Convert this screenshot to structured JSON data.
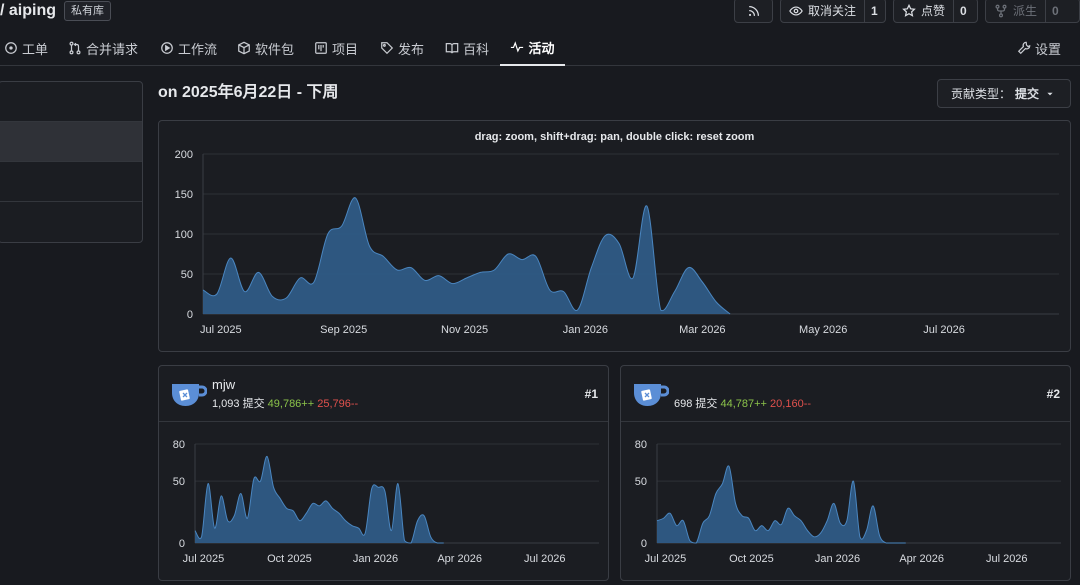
{
  "header": {
    "repo_title": "/ aiping",
    "private_badge": "私有库",
    "rss_icon": "rss-icon",
    "watch": {
      "label": "取消关注",
      "count": "1"
    },
    "star": {
      "label": "点赞",
      "count": "0"
    },
    "fork": {
      "label": "派生",
      "count": "0"
    }
  },
  "tabs": [
    {
      "label": "工单",
      "icon": "issue-icon"
    },
    {
      "label": "合并请求",
      "icon": "pull-request-icon"
    },
    {
      "label": "工作流",
      "icon": "actions-icon"
    },
    {
      "label": "软件包",
      "icon": "package-icon"
    },
    {
      "label": "项目",
      "icon": "project-icon"
    },
    {
      "label": "发布",
      "icon": "tag-icon"
    },
    {
      "label": "百科",
      "icon": "book-icon"
    },
    {
      "label": "活动",
      "icon": "pulse-icon",
      "active": true
    },
    {
      "label": "设置",
      "icon": "tools-icon"
    }
  ],
  "period_title": "on 2025年6月22日 - 下周",
  "contribution_type": {
    "label": "贡献类型：",
    "value": "提交"
  },
  "main_chart": {
    "hint": "drag: zoom, shift+drag: pan, double click: reset zoom"
  },
  "contributors": [
    {
      "name": "mjw",
      "commits": "1,093 提交",
      "additions": "49,786++",
      "deletions": "25,796--",
      "rank": "#1"
    },
    {
      "name": "",
      "commits": "698 提交",
      "additions": "44,787++",
      "deletions": "20,160--",
      "rank": "#2"
    }
  ],
  "colors": {
    "area_fill": "#2f5b86",
    "area_stroke": "#4a86c0",
    "additions": "#8bc34a",
    "deletions": "#e0514d"
  },
  "chart_data": [
    {
      "type": "area",
      "title": "",
      "x_ticks": [
        "Jul 2025",
        "Sep 2025",
        "Nov 2025",
        "Jan 2026",
        "Mar 2026",
        "May 2026",
        "Jul 2026"
      ],
      "x_range": [
        "2025-06-22",
        "2026-08-28"
      ],
      "ylim": [
        0,
        200
      ],
      "y_ticks": [
        0,
        50,
        100,
        150,
        200
      ],
      "grid": true,
      "series": [
        {
          "x": [
            "2025-06-22",
            "2025-06-29",
            "2025-07-06",
            "2025-07-13",
            "2025-07-20",
            "2025-07-27",
            "2025-08-03",
            "2025-08-10",
            "2025-08-17",
            "2025-08-24",
            "2025-08-31",
            "2025-09-07",
            "2025-09-14",
            "2025-09-21",
            "2025-09-28",
            "2025-10-05",
            "2025-10-12",
            "2025-10-19",
            "2025-10-26",
            "2025-11-02",
            "2025-11-09",
            "2025-11-16",
            "2025-11-23",
            "2025-11-30",
            "2025-12-07",
            "2025-12-14",
            "2025-12-21",
            "2025-12-28",
            "2026-01-04",
            "2026-01-11",
            "2026-01-18",
            "2026-01-25",
            "2026-02-01",
            "2026-02-08",
            "2026-02-15",
            "2026-02-22",
            "2026-03-01",
            "2026-03-08",
            "2026-03-15"
          ],
          "values": [
            30,
            25,
            70,
            28,
            52,
            22,
            20,
            45,
            40,
            100,
            110,
            145,
            85,
            72,
            55,
            58,
            42,
            48,
            38,
            45,
            52,
            55,
            75,
            68,
            72,
            30,
            28,
            5,
            58,
            98,
            88,
            45,
            135,
            5,
            28,
            58,
            40,
            15,
            0
          ]
        }
      ]
    },
    {
      "type": "area",
      "title": "",
      "x_ticks": [
        "Jul 2025",
        "Oct 2025",
        "Jan 2026",
        "Apr 2026",
        "Jul 2026"
      ],
      "x_range": [
        "2025-06-22",
        "2026-08-28"
      ],
      "ylim": [
        0,
        80
      ],
      "y_ticks": [
        0,
        50,
        80
      ],
      "grid": true,
      "series": [
        {
          "x": [
            "2025-06-22",
            "2025-06-29",
            "2025-07-06",
            "2025-07-13",
            "2025-07-20",
            "2025-07-27",
            "2025-08-03",
            "2025-08-10",
            "2025-08-17",
            "2025-08-24",
            "2025-08-31",
            "2025-09-07",
            "2025-09-14",
            "2025-09-21",
            "2025-09-28",
            "2025-10-05",
            "2025-10-12",
            "2025-10-19",
            "2025-10-26",
            "2025-11-02",
            "2025-11-09",
            "2025-11-16",
            "2025-11-23",
            "2025-11-30",
            "2025-12-07",
            "2025-12-14",
            "2025-12-21",
            "2025-12-28",
            "2026-01-04",
            "2026-01-11",
            "2026-01-18",
            "2026-01-25",
            "2026-02-01",
            "2026-02-08",
            "2026-02-15",
            "2026-02-22",
            "2026-03-01",
            "2026-03-08",
            "2026-03-15"
          ],
          "values": [
            10,
            5,
            48,
            12,
            38,
            18,
            22,
            40,
            20,
            52,
            50,
            70,
            45,
            36,
            28,
            26,
            18,
            24,
            32,
            30,
            34,
            28,
            24,
            18,
            14,
            12,
            8,
            44,
            45,
            42,
            10,
            48,
            2,
            0,
            18,
            22,
            5,
            0,
            0
          ]
        }
      ]
    },
    {
      "type": "area",
      "title": "",
      "x_ticks": [
        "Jul 2025",
        "Oct 2025",
        "Jan 2026",
        "Apr 2026",
        "Jul 2026"
      ],
      "x_range": [
        "2025-06-22",
        "2026-08-28"
      ],
      "ylim": [
        0,
        80
      ],
      "y_ticks": [
        0,
        50,
        80
      ],
      "grid": true,
      "series": [
        {
          "x": [
            "2025-06-22",
            "2025-06-29",
            "2025-07-06",
            "2025-07-13",
            "2025-07-20",
            "2025-07-27",
            "2025-08-03",
            "2025-08-10",
            "2025-08-17",
            "2025-08-24",
            "2025-08-31",
            "2025-09-07",
            "2025-09-14",
            "2025-09-21",
            "2025-09-28",
            "2025-10-05",
            "2025-10-12",
            "2025-10-19",
            "2025-10-26",
            "2025-11-02",
            "2025-11-09",
            "2025-11-16",
            "2025-11-23",
            "2025-11-30",
            "2025-12-07",
            "2025-12-14",
            "2025-12-21",
            "2025-12-28",
            "2026-01-04",
            "2026-01-11",
            "2026-01-18",
            "2026-01-25",
            "2026-02-01",
            "2026-02-08",
            "2026-02-15",
            "2026-02-22",
            "2026-03-01",
            "2026-03-08",
            "2026-03-15"
          ],
          "values": [
            18,
            20,
            24,
            14,
            18,
            2,
            0,
            16,
            22,
            40,
            48,
            62,
            32,
            22,
            20,
            10,
            14,
            10,
            18,
            15,
            28,
            22,
            18,
            10,
            5,
            8,
            18,
            32,
            16,
            18,
            50,
            5,
            10,
            30,
            6,
            0,
            0,
            0,
            0
          ]
        }
      ]
    }
  ]
}
